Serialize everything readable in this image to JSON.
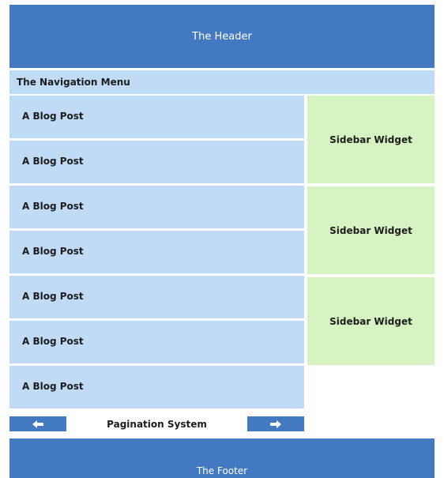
{
  "header": {
    "label": "The Header"
  },
  "nav": {
    "label": "The Navigation Menu"
  },
  "posts": [
    {
      "label": "A Blog Post"
    },
    {
      "label": "A Blog Post"
    },
    {
      "label": "A Blog Post"
    },
    {
      "label": "A Blog Post"
    },
    {
      "label": "A Blog Post"
    },
    {
      "label": "A Blog Post"
    },
    {
      "label": "A Blog Post"
    }
  ],
  "sidebar": {
    "widgets": [
      {
        "label": "Sidebar Widget"
      },
      {
        "label": "Sidebar Widget"
      },
      {
        "label": "Sidebar Widget"
      }
    ]
  },
  "pagination": {
    "label": "Pagination System",
    "prev_icon": "left-arrow-icon",
    "next_icon": "right-arrow-icon"
  },
  "footer": {
    "label": "The Footer"
  },
  "colors": {
    "primary_blue": "#4279c0",
    "light_blue": "#c0dbf6",
    "light_green": "#d5f4c1"
  }
}
